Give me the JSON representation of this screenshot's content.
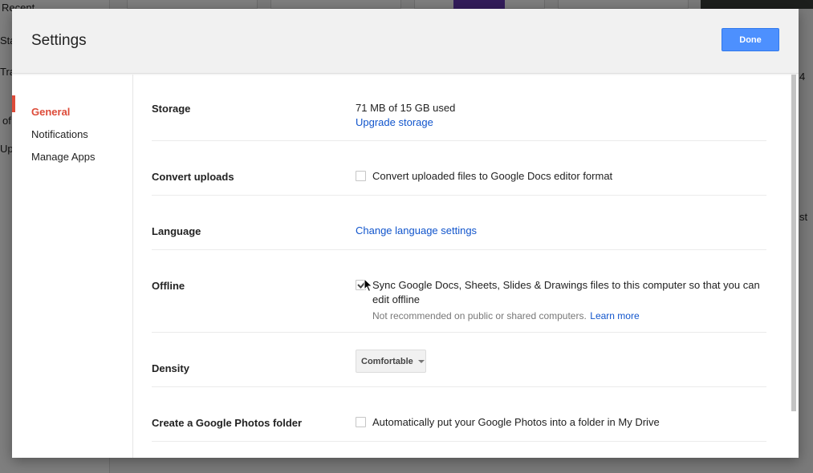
{
  "background": {
    "nav_items": [
      "Recent",
      "Sta",
      "Tra",
      "of",
      "Upg"
    ],
    "right_texts": [
      "4",
      "st"
    ]
  },
  "dialog": {
    "title": "Settings",
    "done_label": "Done"
  },
  "sidebar": {
    "items": [
      {
        "label": "General",
        "active": true
      },
      {
        "label": "Notifications",
        "active": false
      },
      {
        "label": "Manage Apps",
        "active": false
      }
    ]
  },
  "settings": {
    "storage": {
      "label": "Storage",
      "usage": "71 MB of 15 GB used",
      "upgrade_link": "Upgrade storage"
    },
    "convert": {
      "label": "Convert uploads",
      "checkbox_label": "Convert uploaded files to Google Docs editor format",
      "checked": false
    },
    "language": {
      "label": "Language",
      "link": "Change language settings"
    },
    "offline": {
      "label": "Offline",
      "checkbox_label_line1": "Sync Google Docs, Sheets, Slides & Drawings files to this computer so that you can",
      "checkbox_label_line2": "edit offline",
      "note": "Not recommended on public or shared computers.",
      "learn_more": "Learn more",
      "checked": true
    },
    "density": {
      "label": "Density",
      "selected": "Comfortable"
    },
    "photos": {
      "label": "Create a Google Photos folder",
      "checkbox_label": "Automatically put your Google Photos into a folder in My Drive",
      "checked": false
    }
  },
  "colors": {
    "accent_red": "#dd4b39",
    "link_blue": "#1155cc",
    "button_blue": "#4d90fe"
  }
}
